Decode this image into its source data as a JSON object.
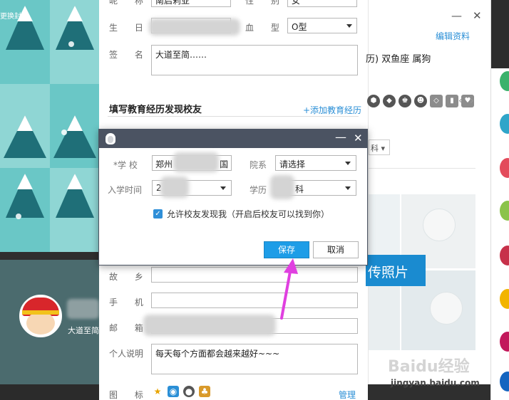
{
  "left_panel": {
    "cover_label": "更换封面",
    "signature_preview": "大道至简"
  },
  "profile": {
    "nickname_label": "昵 称",
    "nickname_value": "南启莉亚",
    "gender_label": "性 别",
    "gender_value": "女",
    "birthday_label": "生 日",
    "blood_label": "血 型",
    "blood_value": "O型",
    "signature_label": "签 名",
    "signature_value": "大道至简……",
    "edu_title": "填写教育经历发现校友",
    "edu_add": "+添加教育经历",
    "hometown_label": "故 乡",
    "phone_label": "手 机",
    "email_label": "邮 箱",
    "desc_label": "个人说明",
    "desc_value": "每天每个方面都会越来越好~~~",
    "icons_label": "图 标",
    "manage_link": "管理"
  },
  "right_window": {
    "edit_profile": "编辑资料",
    "tags": "历) 双鱼座 属狗",
    "subject_tag": "科",
    "upload_button": "传照片",
    "min_icon": "—",
    "close_icon": "✕"
  },
  "dialog": {
    "school_label": "*学 校",
    "school_value": "郑州",
    "school_value_end": "国",
    "dept_label": "院系",
    "dept_value": "请选择",
    "year_label": "入学时间",
    "year_value": "2",
    "degree_label": "学历",
    "degree_value": "科",
    "allow_text": "允许校友发现我（开启后校友可以找到你）",
    "save_button": "保存",
    "cancel_button": "取消",
    "min_icon": "—",
    "close_icon": "✕"
  },
  "watermark": {
    "site": "jingyan.baidu.com",
    "brand": "Baidu经验"
  },
  "colors": {
    "accent_blue": "#1e9de7",
    "link_blue": "#2b8fd6",
    "dialog_title": "#4b5362",
    "arrow": "#e040e0"
  }
}
